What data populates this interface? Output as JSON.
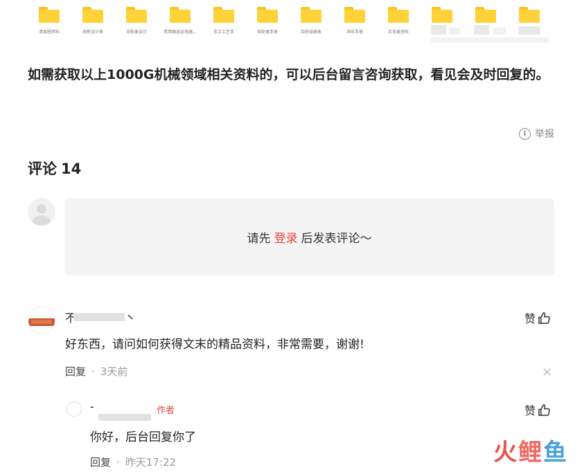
{
  "folders": [
    {
      "label": "清爱圈资料"
    },
    {
      "label": "改新设计表"
    },
    {
      "label": "导轨类设计"
    },
    {
      "label": "常用输送运电器..."
    },
    {
      "label": "车工工艺手"
    },
    {
      "label": "齿轮类手册"
    },
    {
      "label": "齿轮结类表"
    },
    {
      "label": "冲压手册"
    },
    {
      "label": "叉车类资料"
    }
  ],
  "article": {
    "text": "如需获取以上1000G机械领域相关资料的，可以后台留言咨询获取，看见会及时回复的。"
  },
  "report": {
    "icon": "info-icon",
    "label": "举报"
  },
  "comments_section": {
    "title": "评论",
    "count": "14",
    "login_prompt_before": "请先",
    "login_link": "登录",
    "login_prompt_after": "后发表评论～"
  },
  "comments": [
    {
      "username": "不",
      "username_tail": "丶",
      "text": "好东西，请问如何获得文末的精品资料，非常需要，谢谢!",
      "reply_label": "回复",
      "time": "3天前",
      "like_label": "赞"
    }
  ],
  "replies": [
    {
      "username": "-",
      "author_tag": "作者",
      "text": "你好，后台回复你了",
      "reply_label": "回复",
      "time": "昨天17:22",
      "like_label": "赞"
    }
  ],
  "watermark": {
    "text1": "火",
    "text2": "鲤",
    "text3": "鱼"
  },
  "colors": {
    "accent": "#e6453c",
    "folder": "#ffd23a",
    "login_bg": "#f4f4f5"
  }
}
